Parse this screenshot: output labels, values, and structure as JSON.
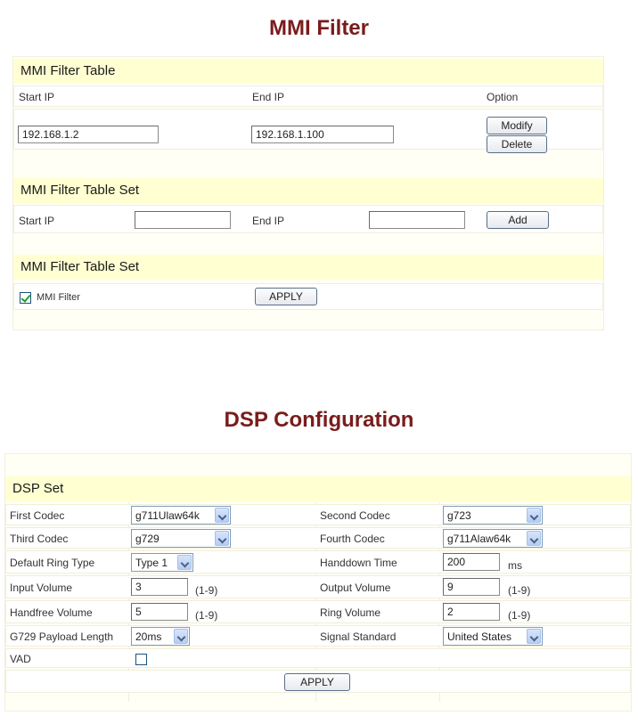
{
  "mmi": {
    "title": "MMI Filter",
    "table": {
      "heading": "MMI Filter Table",
      "col_start": "Start IP",
      "col_end": "End IP",
      "col_option": "Option",
      "row": {
        "start_ip": "192.168.1.2",
        "end_ip": "192.168.1.100"
      },
      "modify_label": "Modify",
      "delete_label": "Delete"
    },
    "set": {
      "heading": "MMI Filter Table Set",
      "start_label": "Start IP",
      "end_label": "End IP",
      "start_value": "",
      "end_value": "",
      "add_label": "Add"
    },
    "enable": {
      "heading": "MMI Filter Table Set",
      "checkbox_label": "MMI Filter",
      "checked": true,
      "apply_label": "APPLY"
    }
  },
  "dsp": {
    "title": "DSP Configuration",
    "heading": "DSP Set",
    "first_codec": {
      "label": "First Codec",
      "value": "g711Ulaw64k"
    },
    "second_codec": {
      "label": "Second Codec",
      "value": "g723"
    },
    "third_codec": {
      "label": "Third Codec",
      "value": "g729"
    },
    "fourth_codec": {
      "label": "Fourth Codec",
      "value": "g711Alaw64k"
    },
    "ring_type": {
      "label": "Default Ring Type",
      "value": "Type 1"
    },
    "handdown": {
      "label": "Handdown Time",
      "value": "200",
      "unit": "ms"
    },
    "input_volume": {
      "label": "Input Volume",
      "value": "3",
      "range": "(1-9)"
    },
    "output_volume": {
      "label": "Output Volume",
      "value": "9",
      "range": "(1-9)"
    },
    "handfree_volume": {
      "label": "Handfree Volume",
      "value": "5",
      "range": "(1-9)"
    },
    "ring_volume": {
      "label": "Ring Volume",
      "value": "2",
      "range": "(1-9)"
    },
    "payload": {
      "label": "G729 Payload Length",
      "value": "20ms"
    },
    "signal": {
      "label": "Signal Standard",
      "value": "United States"
    },
    "vad": {
      "label": "VAD",
      "checked": false
    },
    "apply_label": "APPLY"
  },
  "colors": {
    "title": "#7a1c1c",
    "section_header": "#ffffd2",
    "panel_bg": "#fffff5"
  }
}
